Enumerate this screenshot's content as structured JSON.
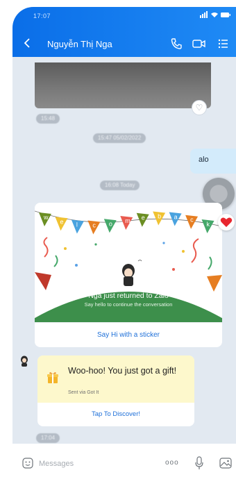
{
  "status_bar": {
    "time": "17:07"
  },
  "header": {
    "title": "Nguyễn Thị Nga"
  },
  "messages": {
    "image_time": "15:48",
    "date_separator": "15:47 05/02/2022",
    "outgoing_text": "alo",
    "today_separator": "16:08 Today",
    "gift_time": "17:04"
  },
  "welcome_card": {
    "title": "Nga just returned to Zalo",
    "subtitle": "Say hello to continue the conversation",
    "action_label": "Say Hi with a sticker",
    "banner_letters": [
      "w",
      "e",
      "l",
      "c",
      "o",
      "m",
      "e",
      "b",
      "a",
      "c",
      "k"
    ]
  },
  "gift_card": {
    "title": "Woo-hoo! You just got a gift!",
    "subtitle": "Sent via Got It",
    "action_label": "Tap To Discover!"
  },
  "composer": {
    "placeholder": "Messages",
    "more_label": "ooo"
  },
  "colors": {
    "header": "#0a6ee8",
    "accent_link": "#1d6fd8",
    "gift_bg": "#fdf8cc",
    "alo_bubble": "#d3ebfb"
  }
}
